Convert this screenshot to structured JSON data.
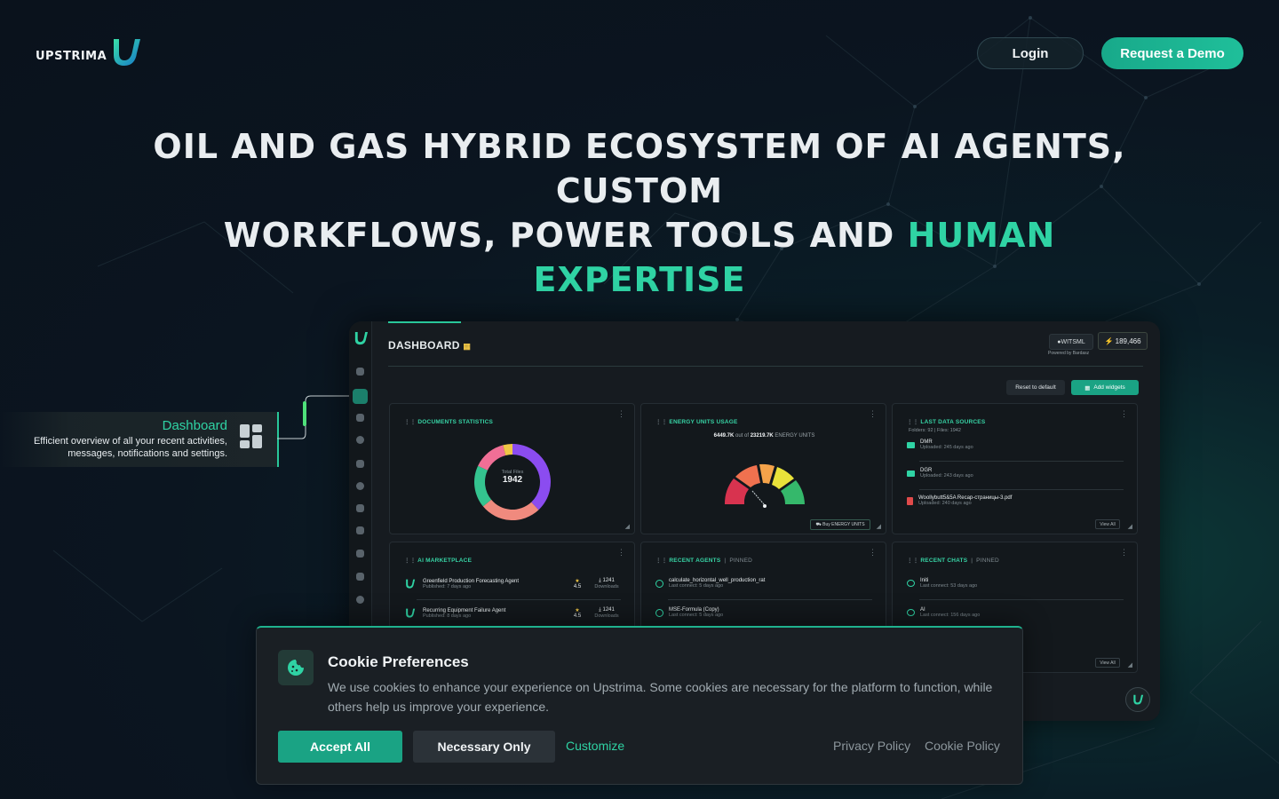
{
  "brand": {
    "name": "UPSTRIMA"
  },
  "header": {
    "login_label": "Login",
    "demo_label": "Request a Demo"
  },
  "hero": {
    "line1": "OIL AND GAS HYBRID ECOSYSTEM OF AI AGENTS, CUSTOM",
    "line2_plain": "WORKFLOWS, POWER TOOLS AND ",
    "line2_accent": "HUMAN EXPERTISE"
  },
  "tooltip": {
    "title": "Dashboard",
    "desc_line1": "Efficient overview of all your recent activities,",
    "desc_line2": "messages, notifications and settings."
  },
  "dashboard": {
    "title": "DASHBOARD",
    "witsml": "WITSML",
    "powered_by": "Powered by Bardasz",
    "units_balance": "189,466",
    "reset_label": "Reset to default",
    "add_label": "Add widgets",
    "documents": {
      "title": "DOCUMENTS STATISTICS",
      "total_label": "Total Files",
      "total_value": "1942"
    },
    "energy": {
      "title": "ENERGY UNITS USAGE",
      "used": "6449.7K",
      "out_of": "out of",
      "total": "23219.7K",
      "unit_label": "ENERGY UNITS",
      "buy_label": "Buy ENERGY UNITS"
    },
    "sources": {
      "title": "LAST DATA SOURCES",
      "summary": "Folders: 92  |  Files: 1942",
      "items": [
        {
          "name": "DMR",
          "meta": "Uploaded: 245 days ago"
        },
        {
          "name": "DGR",
          "meta": "Uploaded: 243 days ago"
        },
        {
          "name": "Woollybutt5&5A Recap-страницы-3.pdf",
          "meta": "Uploaded: 240 days ago"
        }
      ],
      "view_all": "View All"
    },
    "marketplace": {
      "title": "AI MARKETPLACE",
      "items": [
        {
          "name": "Greenfield Production Forecasting Agent",
          "meta": "Published: 7 days ago",
          "rating": "4.5",
          "downloads": "1241",
          "downloads_label": "Downloads"
        },
        {
          "name": "Recurring Equipment Failure Agent",
          "meta": "Published: 8 days ago",
          "rating": "4.5",
          "downloads": "1241",
          "downloads_label": "Downloads"
        }
      ]
    },
    "agents": {
      "title": "RECENT AGENTS",
      "pinned": "PINNED",
      "items": [
        {
          "name": "calculate_horizontal_well_production_rat",
          "meta": "Last connect: 5 days ago"
        },
        {
          "name": "MSE-Formula (Copy)",
          "meta": "Last connect: 5 days ago"
        }
      ]
    },
    "chats": {
      "title": "RECENT CHATS",
      "pinned": "PINNED",
      "items": [
        {
          "name": "Initi",
          "meta": "Last connect: 53 days ago"
        },
        {
          "name": "AI",
          "meta": "Last connect: 156 days ago"
        }
      ],
      "view_all": "View All"
    }
  },
  "cookie": {
    "title": "Cookie Preferences",
    "text": "We use cookies to enhance your experience on Upstrima. Some cookies are necessary for the platform to function, while others help us improve your experience.",
    "accept_label": "Accept All",
    "necessary_label": "Necessary Only",
    "customize_label": "Customize",
    "privacy_label": "Privacy Policy",
    "cookie_policy_label": "Cookie Policy"
  },
  "chart_data": [
    {
      "type": "pie",
      "title": "",
      "labels": [
        "violet",
        "salmon",
        "green",
        "pink",
        "yellow"
      ],
      "values": [
        38,
        26,
        18,
        14,
        4
      ],
      "colors": [
        "#8b4cf0",
        "#f08a7e",
        "#34c38f",
        "#f06f96",
        "#f0c645"
      ]
    }
  ],
  "colors": {
    "accent": "#2fd3a4",
    "button_primary": "#1aa384",
    "gauge": [
      "#d8334f",
      "#f0714f",
      "#f5c64a",
      "#e9e23a",
      "#35b86b"
    ]
  }
}
